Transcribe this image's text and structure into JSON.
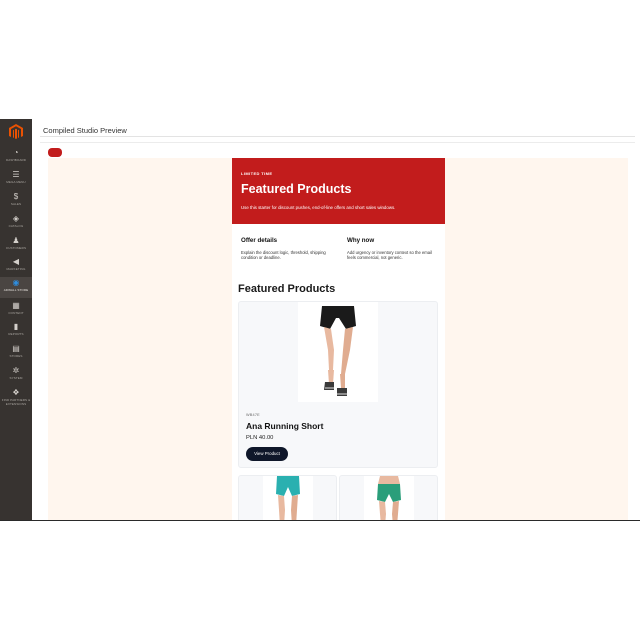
{
  "sidebar": {
    "items": [
      {
        "label": "Dashboard",
        "icon": "dashboard-icon",
        "glyph": "◔"
      },
      {
        "label": "Mega Menu",
        "icon": "mega-menu-icon",
        "glyph": "☰"
      },
      {
        "label": "Sales",
        "icon": "sales-icon",
        "glyph": "$"
      },
      {
        "label": "Catalog",
        "icon": "catalog-icon",
        "glyph": "◈"
      },
      {
        "label": "Customers",
        "icon": "customers-icon",
        "glyph": "♟"
      },
      {
        "label": "Marketing",
        "icon": "marketing-icon",
        "glyph": "◀"
      },
      {
        "label": "Adwall Store",
        "icon": "adwall-store-icon",
        "glyph": "◉"
      },
      {
        "label": "Content",
        "icon": "content-icon",
        "glyph": "▦"
      },
      {
        "label": "Reports",
        "icon": "reports-icon",
        "glyph": "▮"
      },
      {
        "label": "Stores",
        "icon": "stores-icon",
        "glyph": "▤"
      },
      {
        "label": "System",
        "icon": "system-icon",
        "glyph": "✲"
      },
      {
        "label": "Find Partners & Extensions",
        "icon": "extensions-icon",
        "glyph": "❖"
      }
    ]
  },
  "header": {
    "title": "Compiled Studio Preview"
  },
  "email": {
    "hero": {
      "eyebrow": "LIMITED TIME",
      "title": "Featured Products",
      "description": "Use this starter for discount pushes, end-of-line offers and short sales windows."
    },
    "offer": {
      "title": "Offer details",
      "body": "Explain the discount logic, threshold, shipping condition or deadline."
    },
    "why": {
      "title": "Why now",
      "body": "Add urgency or inventory context so the email feels commercial, not generic."
    },
    "section_title": "Featured Products",
    "product": {
      "category": "WB47E",
      "name": "Ana Running Short",
      "price": "PLN 40.00",
      "button": "View Product"
    }
  },
  "colors": {
    "hero_red": "#c21c1c",
    "sidebar": "#373330",
    "canvas": "#fff6ee",
    "button": "#0f172a",
    "magento_orange": "#eb5202"
  }
}
